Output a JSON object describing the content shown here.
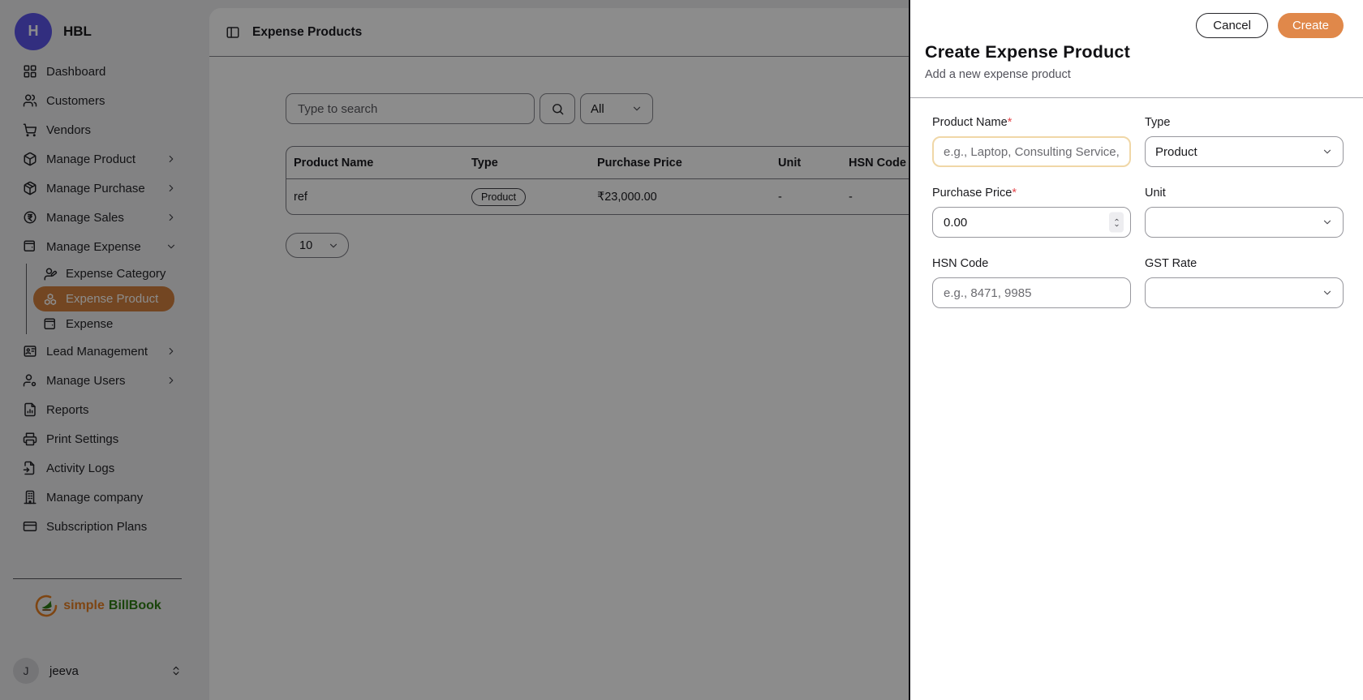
{
  "sidebar": {
    "brand": {
      "initial": "H",
      "name": "HBL"
    },
    "items": [
      {
        "label": "Dashboard"
      },
      {
        "label": "Customers"
      },
      {
        "label": "Vendors"
      },
      {
        "label": "Manage Product"
      },
      {
        "label": "Manage Purchase"
      },
      {
        "label": "Manage Sales"
      },
      {
        "label": "Manage Expense"
      },
      {
        "label": "Lead Management"
      },
      {
        "label": "Manage Users"
      },
      {
        "label": "Reports"
      },
      {
        "label": "Print Settings"
      },
      {
        "label": "Activity Logs"
      },
      {
        "label": "Manage company"
      },
      {
        "label": "Subscription Plans"
      }
    ],
    "expense_submenu": [
      {
        "label": "Expense Category"
      },
      {
        "label": "Expense Product",
        "active": true
      },
      {
        "label": "Expense"
      }
    ],
    "footer": {
      "logo_simple": "simple",
      "logo_billbook": "BillBook"
    },
    "user": {
      "initial": "J",
      "name": "jeeva"
    }
  },
  "main": {
    "title": "Expense Products",
    "search_placeholder": "Type to search",
    "filter_value": "All",
    "table": {
      "columns": [
        "Product Name",
        "Type",
        "Purchase Price",
        "Unit",
        "HSN Code"
      ],
      "rows": [
        {
          "product_name": "ref",
          "type": "Product",
          "purchase_price": "₹23,000.00",
          "unit": "-",
          "hsn_code": "-"
        }
      ]
    },
    "page_size": "10"
  },
  "drawer": {
    "title": "Create Expense Product",
    "subtitle": "Add a new expense product",
    "cancel_label": "Cancel",
    "create_label": "Create",
    "fields": {
      "product_name": {
        "label": "Product Name",
        "required": "*",
        "placeholder": "e.g., Laptop, Consulting Service, C"
      },
      "type": {
        "label": "Type",
        "value": "Product"
      },
      "purchase_price": {
        "label": "Purchase Price",
        "required": "*",
        "value": "0.00"
      },
      "unit": {
        "label": "Unit",
        "value": ""
      },
      "hsn_code": {
        "label": "HSN Code",
        "placeholder": "e.g., 8471, 9985"
      },
      "gst_rate": {
        "label": "GST Rate",
        "value": ""
      }
    }
  },
  "colors": {
    "accent_orange": "#e0884a",
    "active_nav_bg": "#d1803f",
    "brand_purple": "#5b54e8",
    "logo_orange": "#e67e22",
    "logo_green": "#2e7d14",
    "focus_border": "#f0d7a7",
    "overlay": "rgba(0,0,0,0.45)"
  }
}
